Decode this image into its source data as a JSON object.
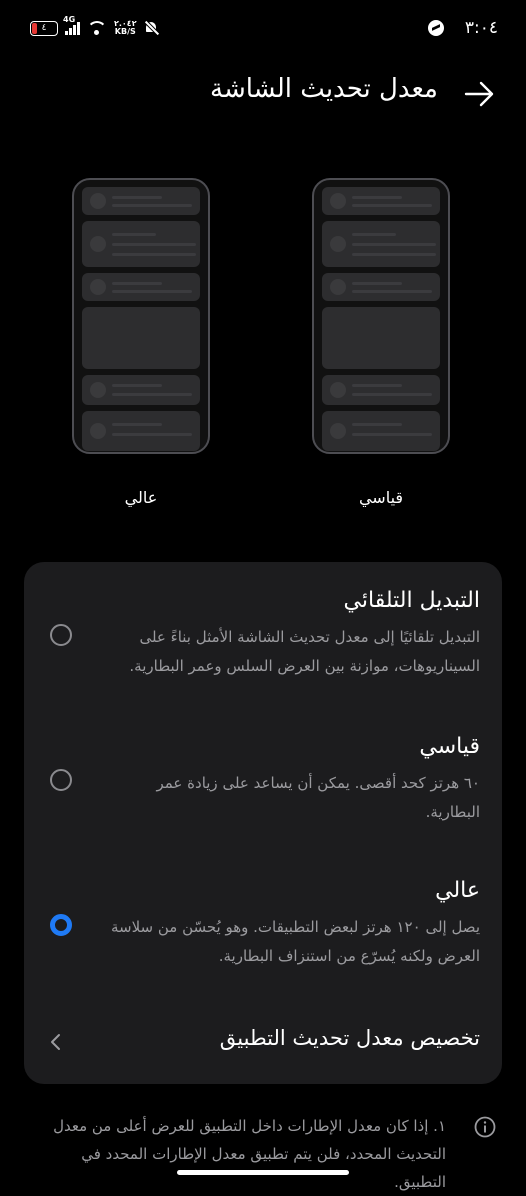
{
  "status_bar": {
    "time": "٣:٠٤",
    "battery": "٤",
    "network": "4G",
    "speed_value": "٢.٠٤٢",
    "speed_unit": "KB/S",
    "icons": [
      "messenger-icon",
      "battery-icon",
      "signal-icon",
      "wifi-icon",
      "bell-off-icon"
    ]
  },
  "header": {
    "title": "معدل تحديث الشاشة",
    "back_icon": "arrow-right-icon"
  },
  "previews": {
    "left_label": "عالي",
    "right_label": "قياسي"
  },
  "options": [
    {
      "title": "التبديل التلقائي",
      "description": "التبديل تلقائيًا إلى معدل تحديث الشاشة الأمثل بناءً على السيناريوهات، موازنة بين العرض السلس وعمر البطارية.",
      "selected": false
    },
    {
      "title": "قياسي",
      "description": "٦٠ هرتز كحد أقصى. يمكن أن يساعد على زيادة عمر البطارية.",
      "selected": false
    },
    {
      "title": "عالي",
      "description": "يصل إلى ١٢٠ هرتز لبعض التطبيقات. وهو يُحسّن من سلاسة العرض ولكنه يُسرّع من استنزاف البطارية.",
      "selected": true
    }
  ],
  "custom": {
    "label": "تخصيص معدل تحديث التطبيق",
    "icon": "chevron-left-icon"
  },
  "note": {
    "text": "١. إذا كان معدل الإطارات داخل التطبيق للعرض أعلى من معدل التحديث المحدد، فلن يتم تطبيق معدل الإطارات المحدد في التطبيق.",
    "icon": "info-icon"
  },
  "colors": {
    "background": "#000000",
    "panel": "#1c1c1e",
    "accent": "#1f7af5",
    "secondary_text": "#9b9b9f"
  }
}
